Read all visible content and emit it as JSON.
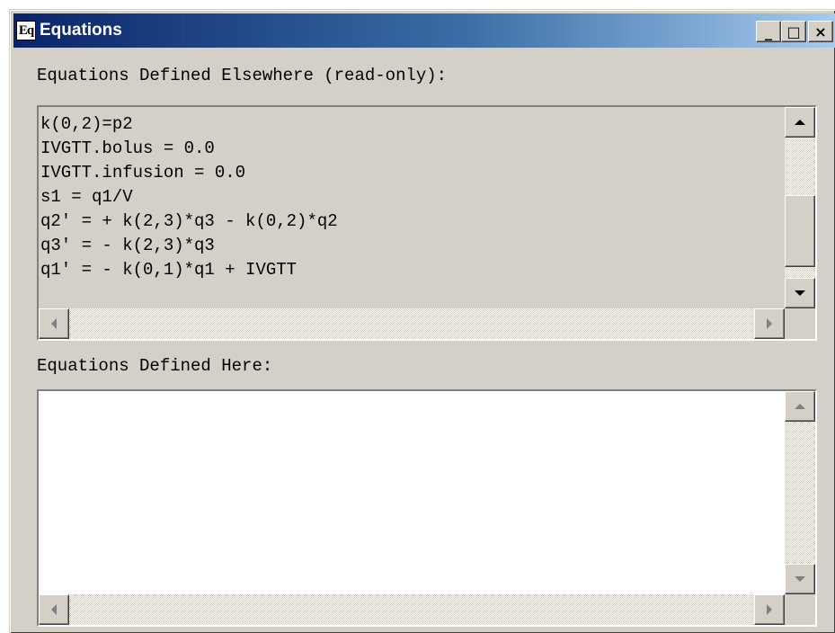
{
  "window": {
    "icon_text": "Eq",
    "title": "Equations",
    "minimize_glyph": "_",
    "maximize_glyph": "□",
    "close_glyph": "×"
  },
  "readonly_section": {
    "label": "Equations Defined Elsewhere (read-only):",
    "lines": [
      "k(0,2)=p2",
      "IVGTT.bolus = 0.0",
      "IVGTT.infusion = 0.0",
      "s1 = q1/V",
      "q2' = + k(2,3)*q3 - k(0,2)*q2",
      "q3' = - k(2,3)*q3",
      "q1' = - k(0,1)*q1 + IVGTT"
    ]
  },
  "editable_section": {
    "label": "Equations Defined Here:",
    "text": ""
  },
  "colors": {
    "face": "#d4d0c8",
    "title_start": "#0a246a",
    "title_end": "#a6caf0"
  }
}
